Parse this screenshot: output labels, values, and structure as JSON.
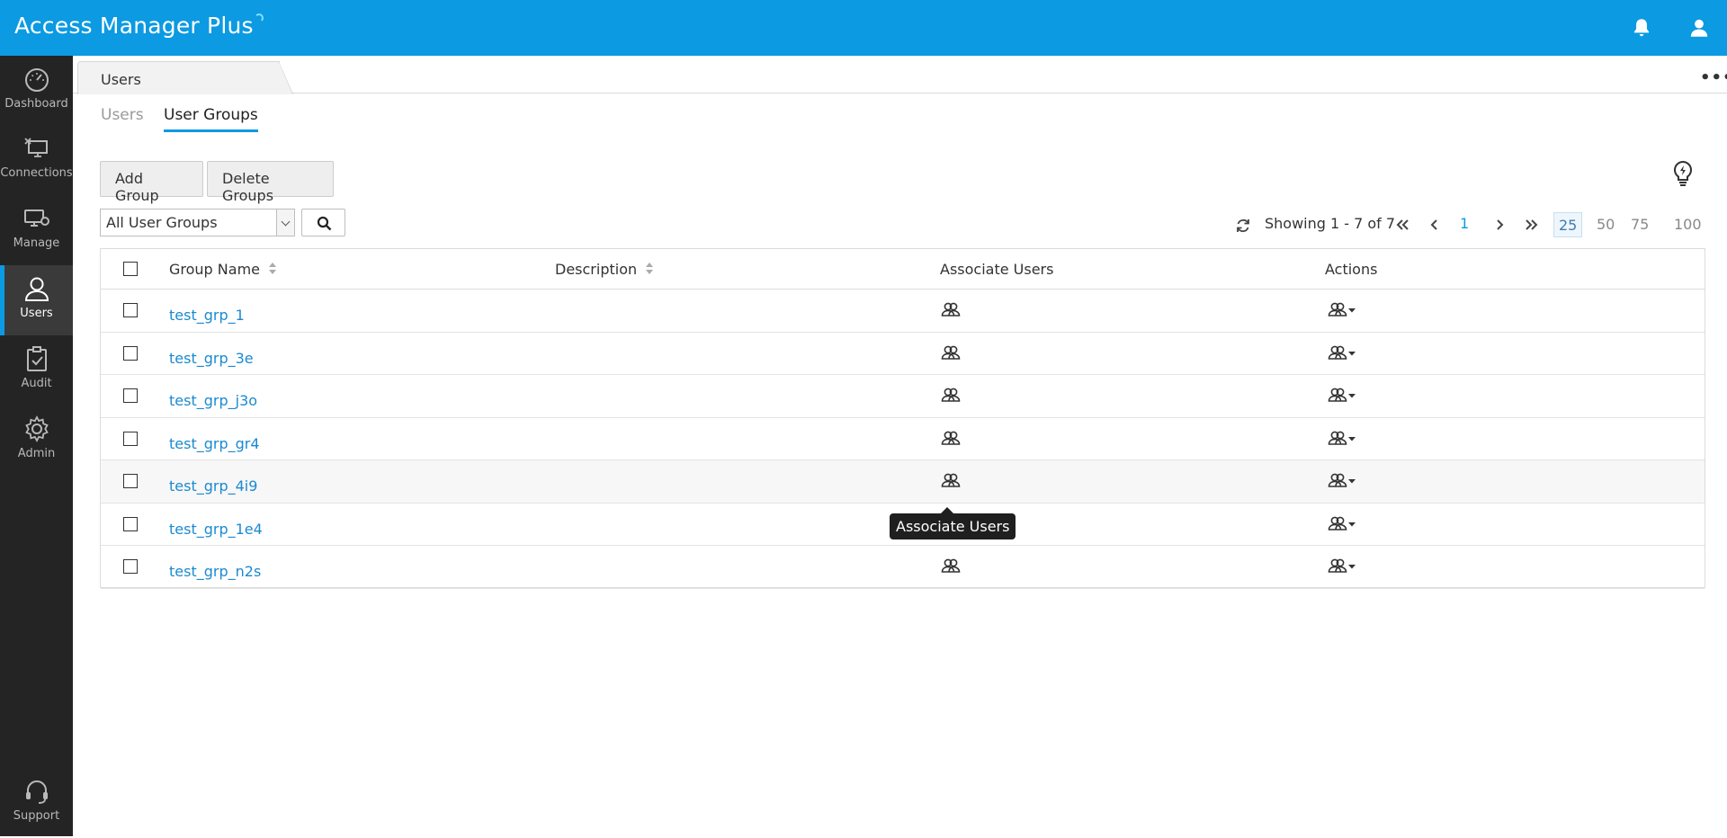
{
  "app": {
    "title": "Access Manager Plus"
  },
  "sidebar": {
    "items": [
      {
        "label": "Dashboard",
        "icon": "dashboard-gauge-icon",
        "active": false
      },
      {
        "label": "Connections",
        "icon": "connections-monitor-icon",
        "active": false
      },
      {
        "label": "Manage",
        "icon": "manage-computer-gear-icon",
        "active": false
      },
      {
        "label": "Users",
        "icon": "user-icon",
        "active": true
      },
      {
        "label": "Audit",
        "icon": "clipboard-check-icon",
        "active": false
      },
      {
        "label": "Admin",
        "icon": "gear-icon",
        "active": false
      }
    ],
    "support": {
      "label": "Support",
      "icon": "headset-icon"
    }
  },
  "page_tab": {
    "label": "Users"
  },
  "subtabs": {
    "users": "Users",
    "groups": "User Groups",
    "active": "User Groups"
  },
  "toolbar": {
    "add_label": "Add Group",
    "delete_label": "Delete Groups"
  },
  "filter": {
    "selected": "All User Groups"
  },
  "pagination": {
    "showing": "Showing 1 - 7 of 7",
    "page": "1",
    "sizes": [
      "25",
      "50",
      "75",
      "100"
    ],
    "active_size": "25"
  },
  "table": {
    "columns": [
      "Group Name",
      "Description",
      "Associate Users",
      "Actions"
    ],
    "rows": [
      {
        "name": "test_grp_1",
        "description": ""
      },
      {
        "name": "test_grp_3e",
        "description": ""
      },
      {
        "name": "test_grp_j3o",
        "description": ""
      },
      {
        "name": "test_grp_gr4",
        "description": ""
      },
      {
        "name": "test_grp_4i9",
        "description": ""
      },
      {
        "name": "test_grp_1e4",
        "description": ""
      },
      {
        "name": "test_grp_n2s",
        "description": ""
      }
    ]
  },
  "tooltip": {
    "text": "Associate Users"
  },
  "colors": {
    "brand": "#0c9ae2",
    "sidebar": "#242424",
    "link": "#1a8ad1"
  }
}
